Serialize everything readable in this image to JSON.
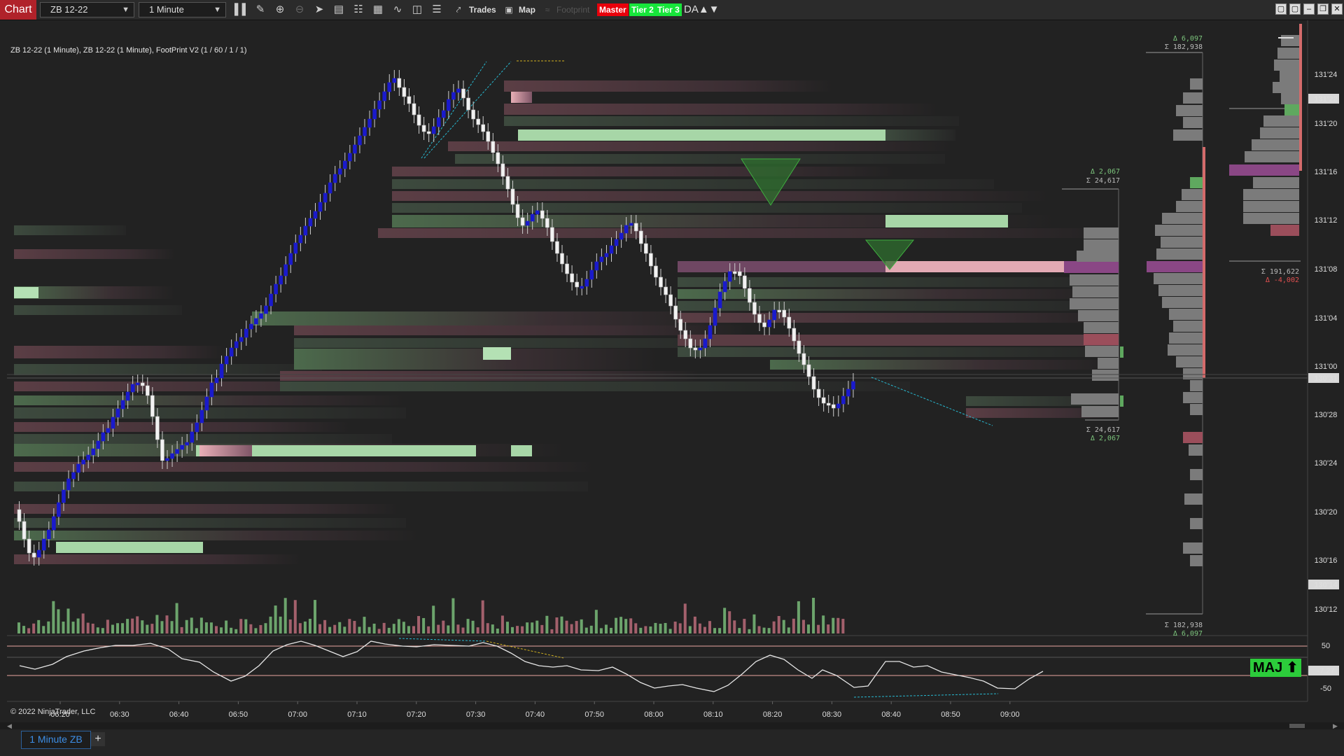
{
  "toolbar": {
    "app_tab": "Chart",
    "instrument": "ZB 12-22",
    "interval": "1 Minute",
    "trades_label": "Trades",
    "map_label": "Map",
    "footprint_label": "Footprint",
    "master_label": "Master",
    "tier2_label": "Tier 2",
    "tier3_label": "Tier 3",
    "da_label": "DA▲▼",
    "colors": {
      "master": "#e8000b",
      "tier": "#17e63b",
      "tab": "#b0222a"
    }
  },
  "chart": {
    "title_line": "ZB 12-22 (1 Minute), ZB 12-22 (1 Minute), FootPrint V2 (1 / 60 / 1 / 1)",
    "copyright": "© 2022 NinjaTrader, LLC",
    "price_ticks": [
      "131'24",
      "131'22",
      "131'20",
      "131'16",
      "131'12",
      "131'08",
      "131'04",
      "131'00",
      "130'31",
      "130'28",
      "130'24",
      "130'20",
      "130'16",
      "130'14",
      "130'12"
    ],
    "highlighted_prices": [
      "131'22",
      "130'31",
      "130'14"
    ],
    "time_ticks": [
      "06:20",
      "06:30",
      "06:40",
      "06:50",
      "07:00",
      "07:10",
      "07:20",
      "07:30",
      "07:40",
      "07:50",
      "08:00",
      "08:10",
      "08:20",
      "08:30",
      "08:40",
      "08:50",
      "09:00"
    ],
    "oscillator_ticks": [
      "50",
      "-7.27",
      "-50"
    ],
    "maj_label": "MAJ"
  },
  "profiles": {
    "session_top_delta": "Δ 6,097",
    "session_top_sum": "Σ 182,938",
    "session_bottom_sum": "Σ 182,938",
    "session_bottom_delta": "Δ 6,097",
    "range_top_delta": "Δ 2,067",
    "range_top_sum": "Σ 24,617",
    "range_bottom_sum": "Σ 24,617",
    "range_bottom_delta": "Δ 2,067",
    "prior_sum": "Σ 191,622",
    "prior_delta": "Δ -4,002"
  },
  "bottom_bar": {
    "tab_label": "1 Minute ZB",
    "add_label": "+"
  }
}
